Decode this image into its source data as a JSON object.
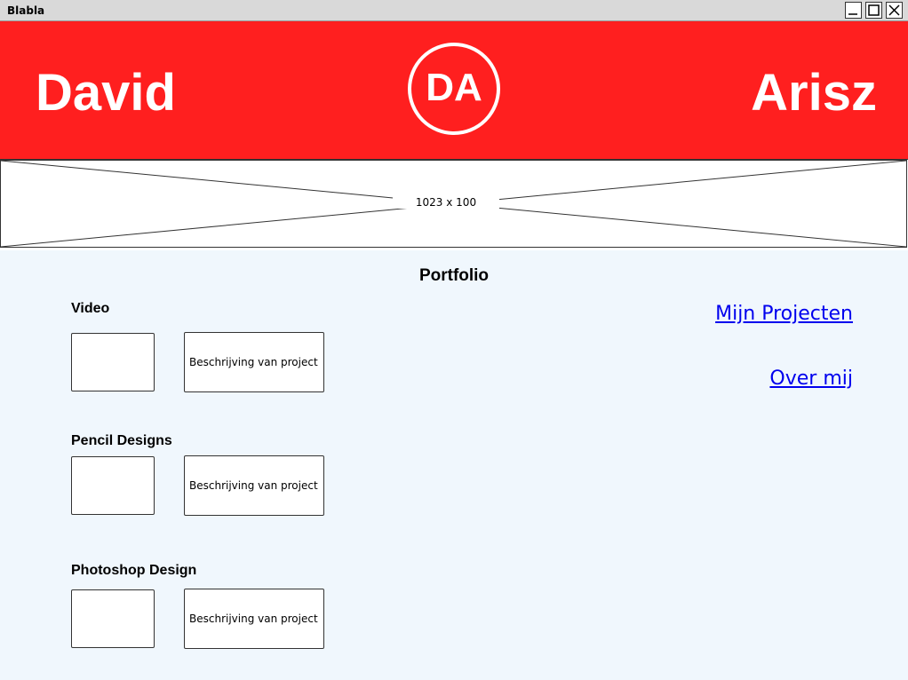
{
  "window": {
    "title": "Blabla",
    "controls": [
      "minimize-icon",
      "maximize-icon",
      "close-icon"
    ]
  },
  "header": {
    "first_name": "David",
    "last_name": "Arisz",
    "logo_text": "DA",
    "background": "#ff1f1f"
  },
  "banner": {
    "size_label": "1023 x 100"
  },
  "main": {
    "title": "Portfolio",
    "background": "#f0f7fd",
    "sections": [
      {
        "title": "Video",
        "description": "Beschrijving van project"
      },
      {
        "title": "Pencil Designs",
        "description": "Beschrijving van project"
      },
      {
        "title": "Photoshop Design",
        "description": "Beschrijving van project"
      }
    ],
    "nav_links": [
      "Mijn Projecten",
      "Over mij"
    ],
    "link_color": "#0000ee"
  }
}
